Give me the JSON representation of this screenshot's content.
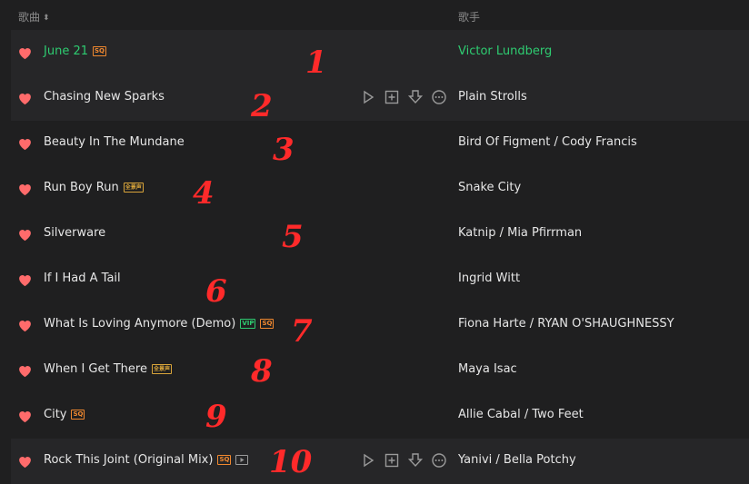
{
  "header": {
    "song_col": "歌曲",
    "sort_icon": "sort-icon",
    "artist_col": "歌手"
  },
  "colors": {
    "accent": "#2ecc71",
    "heart": "#ff6b6b",
    "annotation": "#ff2a2a"
  },
  "rows": [
    {
      "title": "June 21",
      "artist": "Victor Lundberg",
      "badges": [
        "SQ"
      ],
      "playing": true,
      "annotation": "1"
    },
    {
      "title": "Chasing New Sparks",
      "artist": "Plain Strolls",
      "badges": [],
      "hover": true,
      "annotation": "2"
    },
    {
      "title": "Beauty In The Mundane",
      "artist": "Bird Of Figment / Cody Francis",
      "badges": [],
      "annotation": "3"
    },
    {
      "title": "Run Boy Run",
      "artist": "Snake City",
      "badges": [
        "全景声"
      ],
      "annotation": "4"
    },
    {
      "title": "Silverware",
      "artist": "Katnip / Mia Pfirrman",
      "badges": [],
      "annotation": "5"
    },
    {
      "title": "If I Had A Tail",
      "artist": "Ingrid Witt",
      "badges": [],
      "annotation": "6"
    },
    {
      "title": "What Is Loving Anymore (Demo)",
      "artist": "Fiona Harte / RYAN O'SHAUGHNESSY",
      "badges": [
        "VIP",
        "SQ"
      ],
      "annotation": "7"
    },
    {
      "title": "When I Get There",
      "artist": "Maya Isac",
      "badges": [
        "全景声"
      ],
      "annotation": "8"
    },
    {
      "title": "City",
      "artist": "Allie Cabal / Two Feet",
      "badges": [
        "SQ"
      ],
      "annotation": "9"
    },
    {
      "title": "Rock This Joint (Original Mix)",
      "artist": "Yanivi / Bella Potchy",
      "badges": [
        "SQ",
        "MV"
      ],
      "hover": true,
      "annotation": "10"
    }
  ]
}
